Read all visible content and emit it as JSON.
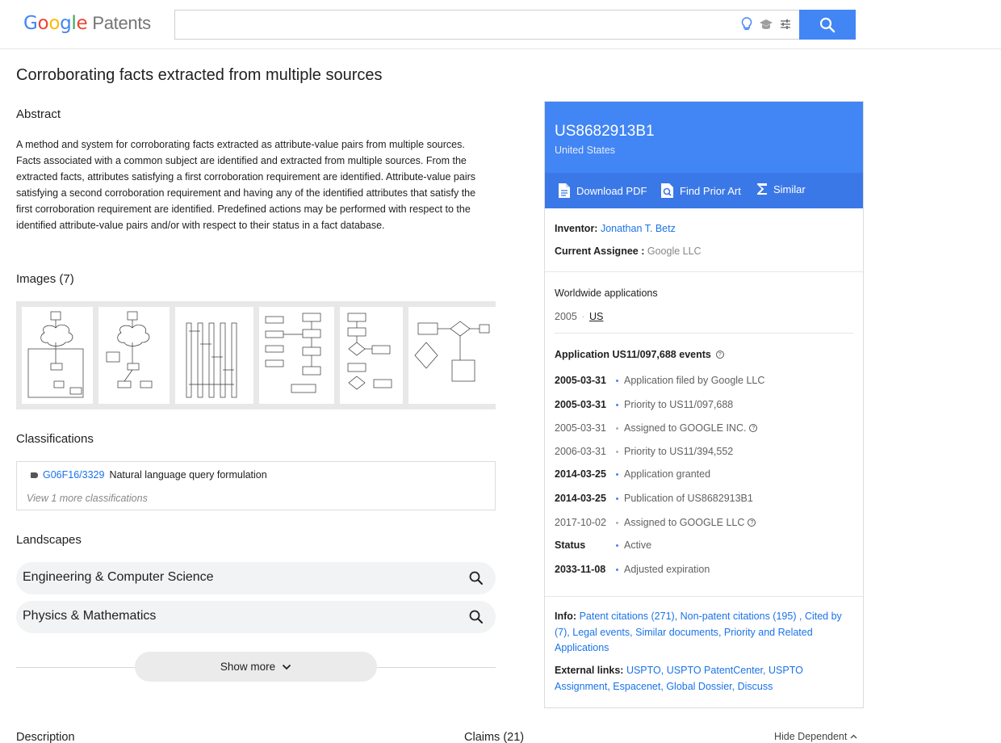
{
  "header": {
    "logo_google": "Google",
    "logo_patents": "Patents",
    "search": {
      "value": "",
      "placeholder": ""
    }
  },
  "title": "Corroborating facts extracted from multiple sources",
  "abstract": {
    "heading": "Abstract",
    "text": "A method and system for corroborating facts extracted as attribute-value pairs from multiple sources. Facts associated with a common subject are identified and extracted from multiple sources. From the extracted facts, attributes satisfying a first corroboration requirement are identified. Attribute-value pairs satisfying a second corroboration requirement and having any of the identified attributes that satisfy the first corroboration requirement are identified. Predefined actions may be performed with respect to the identified attribute-value pairs and/or with respect to their status in a fact database."
  },
  "images": {
    "heading": "Images (7)"
  },
  "classifications": {
    "heading": "Classifications",
    "code": "G06F16/3329",
    "description": "Natural language query formulation",
    "more": "View 1 more classifications"
  },
  "landscapes": {
    "heading": "Landscapes",
    "items": [
      "Engineering & Computer Science",
      "Physics & Mathematics"
    ]
  },
  "show_more": "Show more",
  "bottom": {
    "description": "Description",
    "claims": "Claims (21)",
    "hide_dependent": "Hide Dependent"
  },
  "panel": {
    "pub_number": "US8682913B1",
    "country": "United States",
    "actions": [
      "Download PDF",
      "Find Prior Art",
      "Similar"
    ],
    "inventor_label": "Inventor:",
    "inventor": "Jonathan T. Betz",
    "assignee_label": "Current Assignee :",
    "assignee": "Google LLC",
    "worldwide_heading": "Worldwide applications",
    "worldwide_year": "2005",
    "worldwide_sep": "·",
    "worldwide_country": "US",
    "events_heading": "Application US11/097,688 events",
    "events": [
      {
        "date": "2005-03-31",
        "text": "Application filed by Google LLC",
        "bold": true,
        "help": false
      },
      {
        "date": "2005-03-31",
        "text": "Priority to US11/097,688",
        "bold": true,
        "help": false
      },
      {
        "date": "2005-03-31",
        "text": "Assigned to GOOGLE INC.",
        "bold": false,
        "help": true
      },
      {
        "date": "2006-03-31",
        "text": "Priority to US11/394,552",
        "bold": false,
        "help": false
      },
      {
        "date": "2014-03-25",
        "text": "Application granted",
        "bold": true,
        "help": false
      },
      {
        "date": "2014-03-25",
        "text": "Publication of US8682913B1",
        "bold": true,
        "help": false
      },
      {
        "date": "2017-10-02",
        "text": "Assigned to GOOGLE LLC",
        "bold": false,
        "help": true
      },
      {
        "date": "Status",
        "text": "Active",
        "bold": true,
        "help": false
      },
      {
        "date": "2033-11-08",
        "text": "Adjusted expiration",
        "bold": true,
        "help": false
      }
    ],
    "info_label": "Info:",
    "info_links": [
      "Patent citations (271)",
      "Non-patent citations (195)",
      "Cited by (7)",
      "Legal events",
      "Similar documents",
      "Priority and Related Applications"
    ],
    "external_label": "External links:",
    "external_links": [
      "USPTO",
      "USPTO PatentCenter",
      "USPTO Assignment",
      "Espacenet",
      "Global Dossier",
      "Discuss"
    ]
  },
  "colors": {
    "accent": "#4285f4",
    "accent_dark": "#3b78e7",
    "link": "#1a73e8"
  }
}
